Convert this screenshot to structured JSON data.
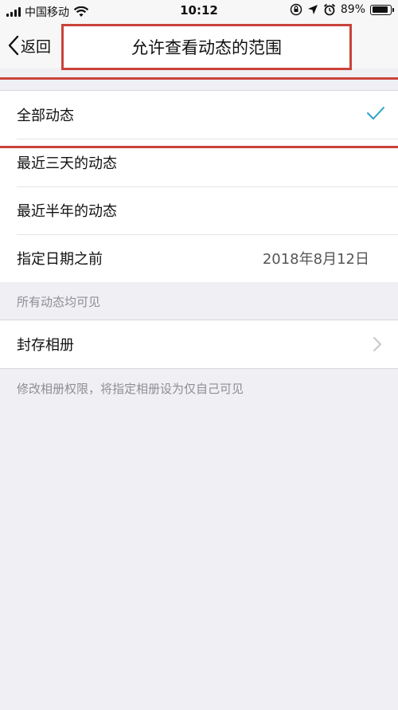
{
  "status_bar": {
    "carrier": "中国移动",
    "time": "10:12",
    "battery": "89%",
    "battery_level": 0.89
  },
  "nav": {
    "back_label": "返回",
    "title": "允许查看动态的范围"
  },
  "options": [
    {
      "label": "全部动态",
      "selected": true
    },
    {
      "label": "最近三天的动态",
      "selected": false
    },
    {
      "label": "最近半年的动态",
      "selected": false
    },
    {
      "label": "指定日期之前",
      "value": "2018年8月12日",
      "selected": false
    }
  ],
  "options_note": "所有动态均可见",
  "album": {
    "label": "封存相册",
    "note": "修改相册权限，将指定相册设为仅自己可见"
  },
  "colors": {
    "highlight": "#c9423a",
    "check": "#2aa3c4"
  }
}
